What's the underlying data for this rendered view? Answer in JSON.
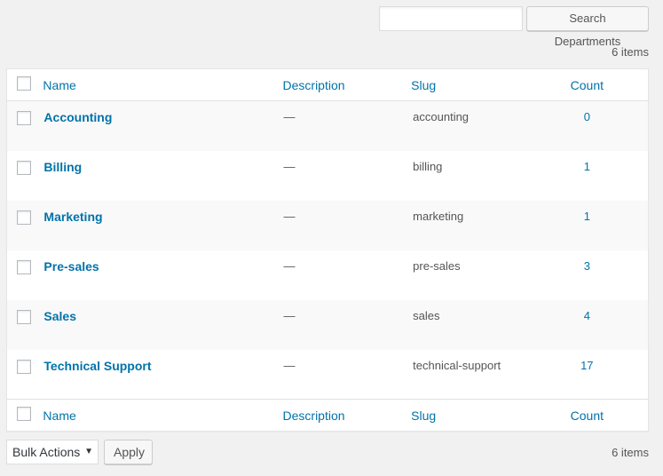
{
  "search": {
    "value": "",
    "button": "Search Departments"
  },
  "items_count": "6 items",
  "columns": {
    "name": "Name",
    "description": "Description",
    "slug": "Slug",
    "count": "Count"
  },
  "rows": [
    {
      "name": "Accounting",
      "description": "—",
      "slug": "accounting",
      "count": "0"
    },
    {
      "name": "Billing",
      "description": "—",
      "slug": "billing",
      "count": "1"
    },
    {
      "name": "Marketing",
      "description": "—",
      "slug": "marketing",
      "count": "1"
    },
    {
      "name": "Pre-sales",
      "description": "—",
      "slug": "pre-sales",
      "count": "3"
    },
    {
      "name": "Sales",
      "description": "—",
      "slug": "sales",
      "count": "4"
    },
    {
      "name": "Technical Support",
      "description": "—",
      "slug": "technical-support",
      "count": "17"
    }
  ],
  "bulk": {
    "selected": "Bulk Actions",
    "apply": "Apply"
  },
  "colors": {
    "link": "#0073aa",
    "background": "#f1f1f1"
  }
}
